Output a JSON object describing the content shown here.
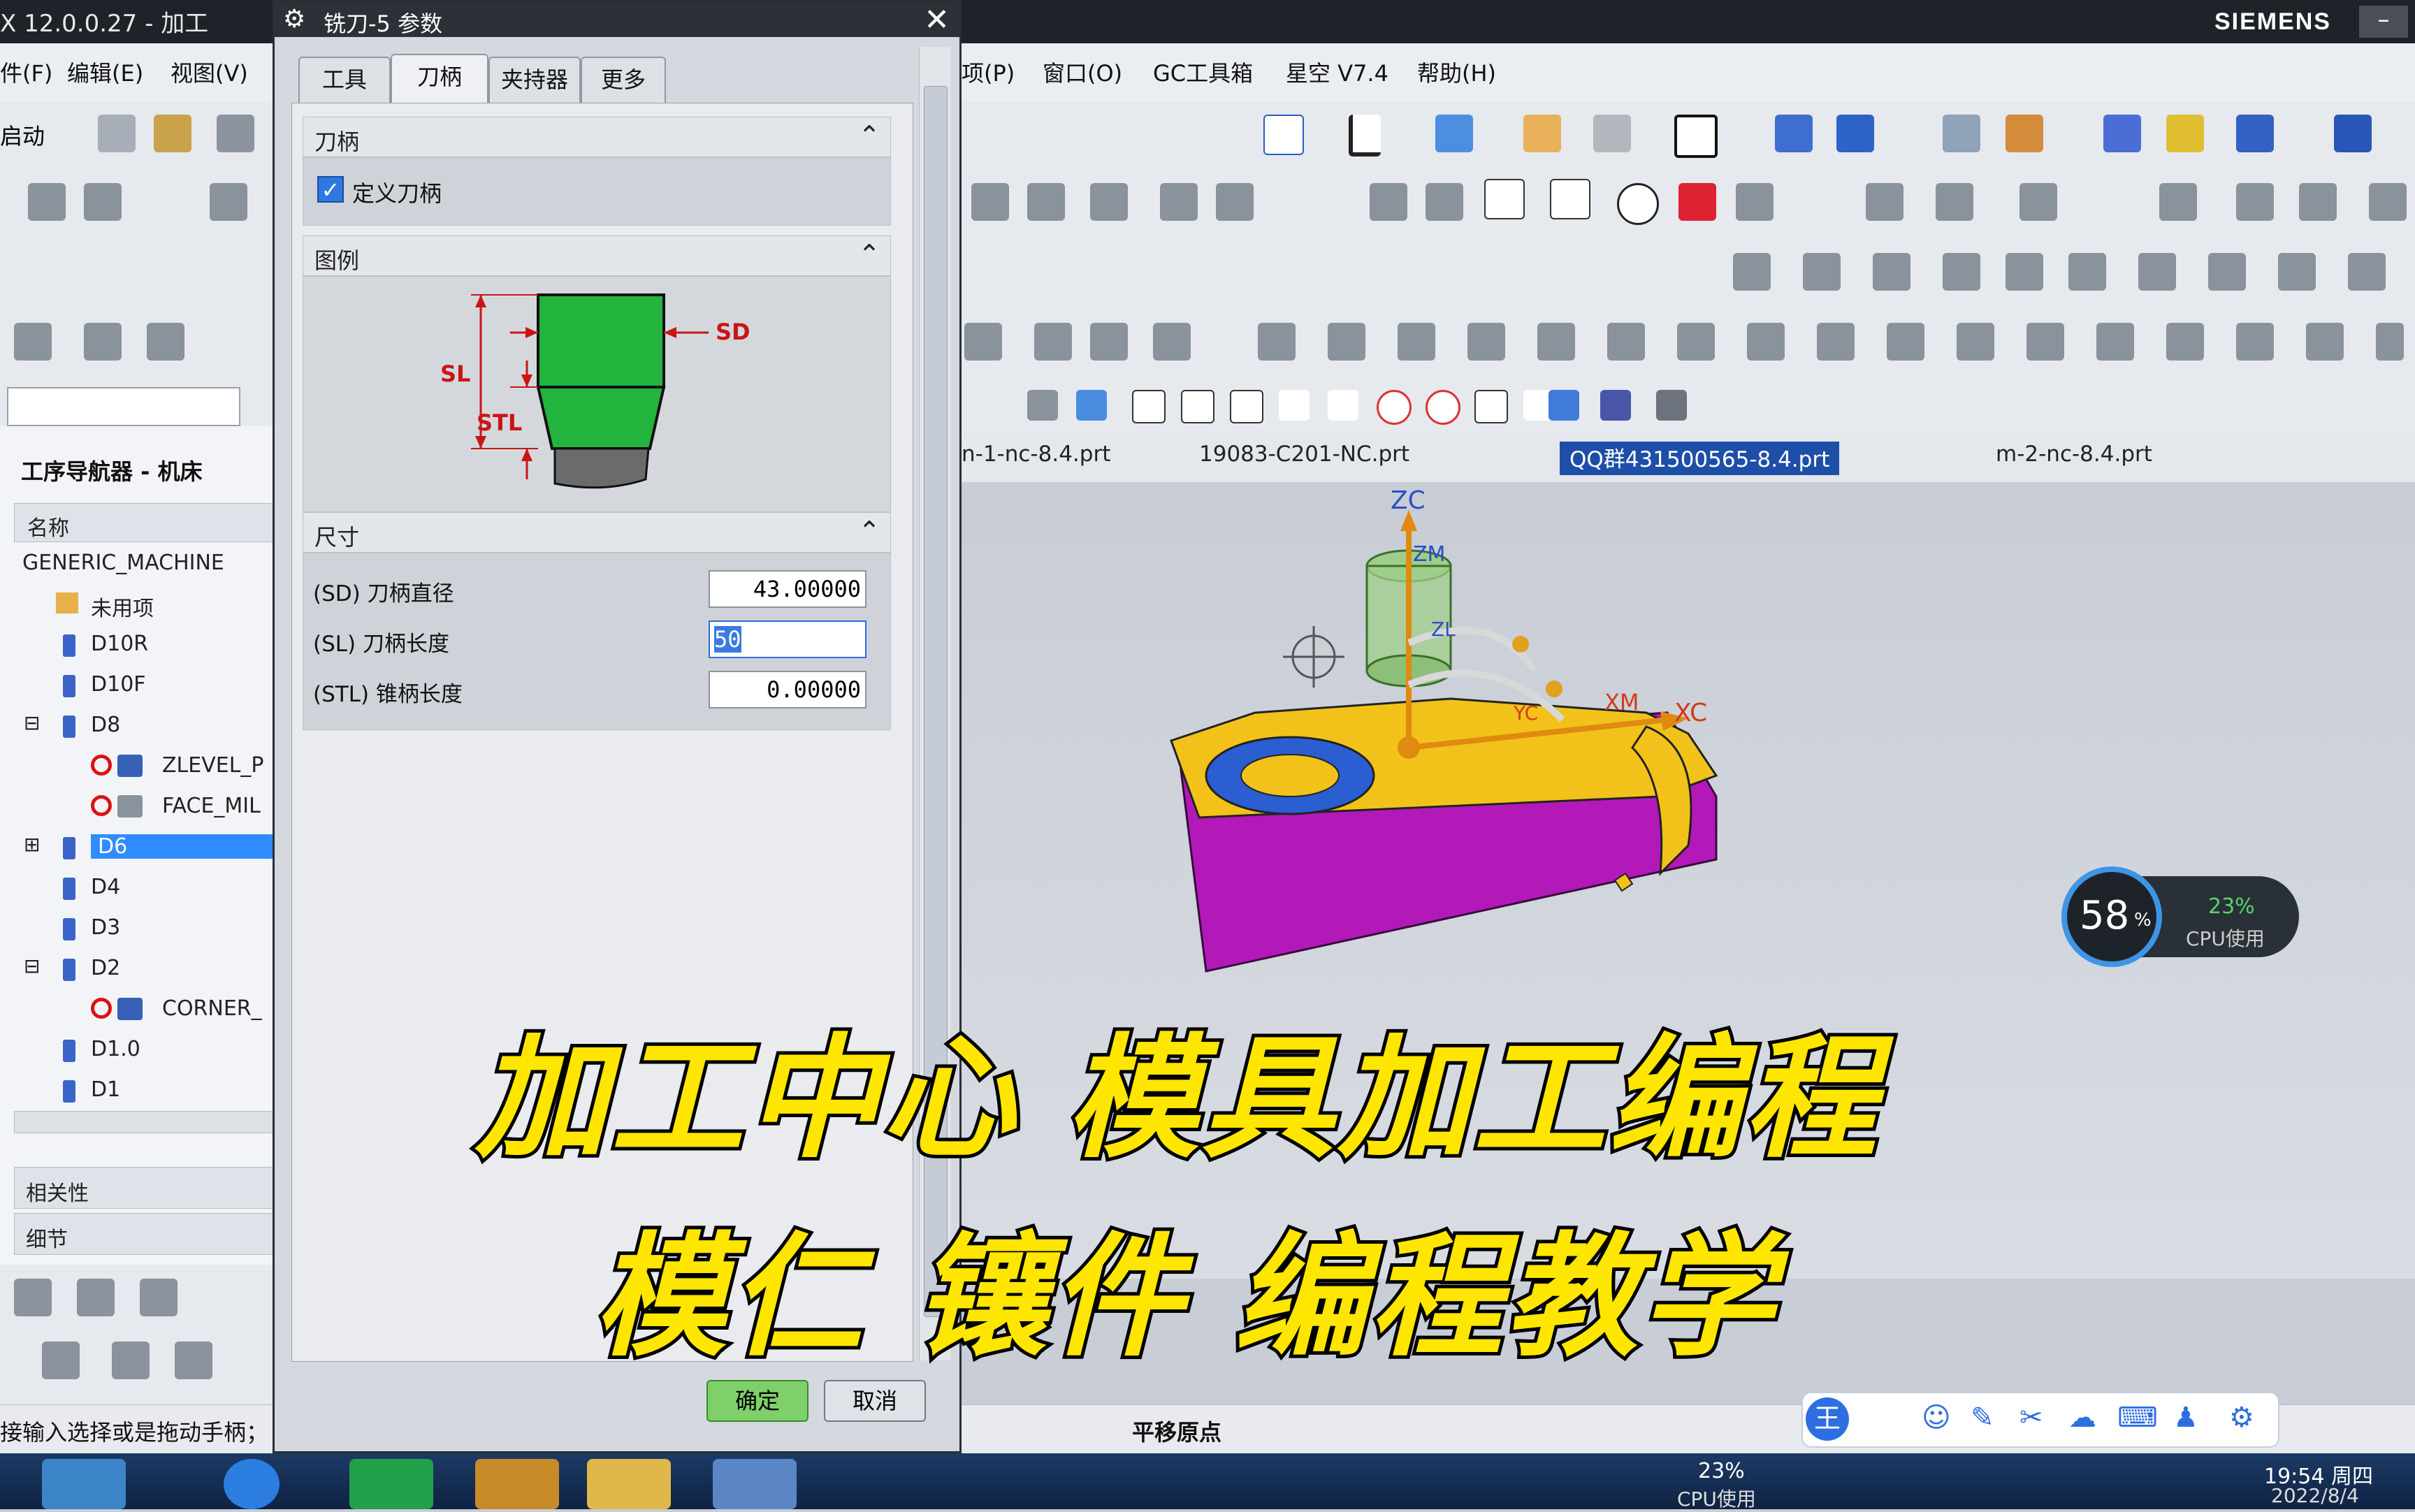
{
  "titlebar": {
    "title": "X 12.0.0.27 - 加工",
    "brand": "SIEMENS"
  },
  "menubar": {
    "left_items": [
      "件(F)",
      "编辑(E)",
      "视图(V)"
    ],
    "right_items": [
      "项(P)",
      "窗口(O)",
      "GC工具箱",
      "星空 V7.4",
      "帮助(H)"
    ]
  },
  "toolbar": {
    "start_label": "启动"
  },
  "navigator": {
    "title": "工序导航器 - 机床",
    "column_header": "名称",
    "rows": [
      {
        "label": "GENERIC_MACHINE"
      },
      {
        "label": "未用项"
      },
      {
        "label": "D10R"
      },
      {
        "label": "D10F"
      },
      {
        "label": "D8"
      },
      {
        "label": "ZLEVEL_P"
      },
      {
        "label": "FACE_MIL"
      },
      {
        "label": "D6"
      },
      {
        "label": "D4"
      },
      {
        "label": "D3"
      },
      {
        "label": "D2"
      },
      {
        "label": "CORNER_"
      },
      {
        "label": "D1.0"
      },
      {
        "label": "D1"
      }
    ],
    "panel_dependencies": "相关性",
    "panel_details": "细节"
  },
  "dialog": {
    "title": "铣刀-5 参数",
    "tabs": [
      "工具",
      "刀柄",
      "夹持器",
      "更多"
    ],
    "active_tab": "刀柄",
    "section_holder": "刀柄",
    "define_holder_label": "定义刀柄",
    "define_holder_checked": true,
    "section_legend": "图例",
    "legend_labels": {
      "sd": "SD",
      "sl": "SL",
      "stl": "STL"
    },
    "section_dimensions": "尺寸",
    "fields": [
      {
        "label": "(SD) 刀柄直径",
        "value": "43.00000"
      },
      {
        "label": "(SL) 刀柄长度",
        "value": "50"
      },
      {
        "label": "(STL) 锥柄长度",
        "value": "0.00000"
      }
    ],
    "ok_label": "确定",
    "cancel_label": "取消"
  },
  "file_tabs": [
    {
      "label": "n-1-nc-8.4.prt"
    },
    {
      "label": "19083-C201-NC.prt"
    },
    {
      "label": "QQ群431500565-8.4.prt",
      "active": true
    },
    {
      "label": "m-2-nc-8.4.prt"
    }
  ],
  "viewport": {
    "axis_labels": {
      "zc": "ZC",
      "zm": "ZM",
      "xc": "XC",
      "xm": "XM",
      "yc": "YC",
      "zl": "ZL"
    },
    "colors": {
      "top_face": "#f2c21a",
      "side_face": "#b219b8",
      "tool": "#9fce8a"
    }
  },
  "cpu_widget": {
    "main_percent": "58",
    "unit": "%",
    "secondary_percent": "23%",
    "secondary_label": "CPU使用"
  },
  "caption": {
    "line1": "加工中心 模具加工编程",
    "line2": "模仁 镶件 编程教学"
  },
  "statusbar": {
    "message": "接输入选择或是拖动手柄；",
    "position_label": "平移原点"
  },
  "taskbar": {
    "cpu_percent": "23%",
    "cpu_label": "CPU使用",
    "time": "19:54 周四",
    "date": "2022/8/4"
  }
}
